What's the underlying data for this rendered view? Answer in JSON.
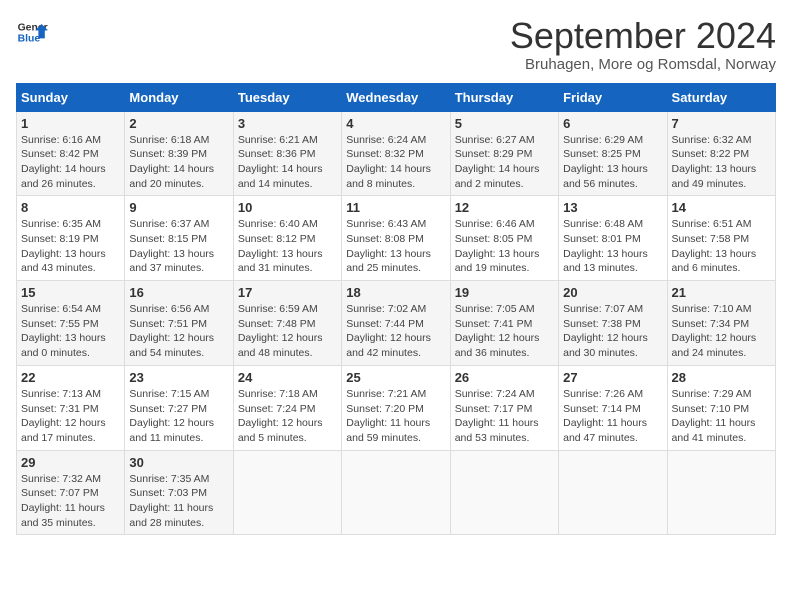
{
  "header": {
    "logo_line1": "General",
    "logo_line2": "Blue",
    "month": "September 2024",
    "location": "Bruhagen, More og Romsdal, Norway"
  },
  "weekdays": [
    "Sunday",
    "Monday",
    "Tuesday",
    "Wednesday",
    "Thursday",
    "Friday",
    "Saturday"
  ],
  "weeks": [
    [
      {
        "day": "1",
        "info": "Sunrise: 6:16 AM\nSunset: 8:42 PM\nDaylight: 14 hours\nand 26 minutes."
      },
      {
        "day": "2",
        "info": "Sunrise: 6:18 AM\nSunset: 8:39 PM\nDaylight: 14 hours\nand 20 minutes."
      },
      {
        "day": "3",
        "info": "Sunrise: 6:21 AM\nSunset: 8:36 PM\nDaylight: 14 hours\nand 14 minutes."
      },
      {
        "day": "4",
        "info": "Sunrise: 6:24 AM\nSunset: 8:32 PM\nDaylight: 14 hours\nand 8 minutes."
      },
      {
        "day": "5",
        "info": "Sunrise: 6:27 AM\nSunset: 8:29 PM\nDaylight: 14 hours\nand 2 minutes."
      },
      {
        "day": "6",
        "info": "Sunrise: 6:29 AM\nSunset: 8:25 PM\nDaylight: 13 hours\nand 56 minutes."
      },
      {
        "day": "7",
        "info": "Sunrise: 6:32 AM\nSunset: 8:22 PM\nDaylight: 13 hours\nand 49 minutes."
      }
    ],
    [
      {
        "day": "8",
        "info": "Sunrise: 6:35 AM\nSunset: 8:19 PM\nDaylight: 13 hours\nand 43 minutes."
      },
      {
        "day": "9",
        "info": "Sunrise: 6:37 AM\nSunset: 8:15 PM\nDaylight: 13 hours\nand 37 minutes."
      },
      {
        "day": "10",
        "info": "Sunrise: 6:40 AM\nSunset: 8:12 PM\nDaylight: 13 hours\nand 31 minutes."
      },
      {
        "day": "11",
        "info": "Sunrise: 6:43 AM\nSunset: 8:08 PM\nDaylight: 13 hours\nand 25 minutes."
      },
      {
        "day": "12",
        "info": "Sunrise: 6:46 AM\nSunset: 8:05 PM\nDaylight: 13 hours\nand 19 minutes."
      },
      {
        "day": "13",
        "info": "Sunrise: 6:48 AM\nSunset: 8:01 PM\nDaylight: 13 hours\nand 13 minutes."
      },
      {
        "day": "14",
        "info": "Sunrise: 6:51 AM\nSunset: 7:58 PM\nDaylight: 13 hours\nand 6 minutes."
      }
    ],
    [
      {
        "day": "15",
        "info": "Sunrise: 6:54 AM\nSunset: 7:55 PM\nDaylight: 13 hours\nand 0 minutes."
      },
      {
        "day": "16",
        "info": "Sunrise: 6:56 AM\nSunset: 7:51 PM\nDaylight: 12 hours\nand 54 minutes."
      },
      {
        "day": "17",
        "info": "Sunrise: 6:59 AM\nSunset: 7:48 PM\nDaylight: 12 hours\nand 48 minutes."
      },
      {
        "day": "18",
        "info": "Sunrise: 7:02 AM\nSunset: 7:44 PM\nDaylight: 12 hours\nand 42 minutes."
      },
      {
        "day": "19",
        "info": "Sunrise: 7:05 AM\nSunset: 7:41 PM\nDaylight: 12 hours\nand 36 minutes."
      },
      {
        "day": "20",
        "info": "Sunrise: 7:07 AM\nSunset: 7:38 PM\nDaylight: 12 hours\nand 30 minutes."
      },
      {
        "day": "21",
        "info": "Sunrise: 7:10 AM\nSunset: 7:34 PM\nDaylight: 12 hours\nand 24 minutes."
      }
    ],
    [
      {
        "day": "22",
        "info": "Sunrise: 7:13 AM\nSunset: 7:31 PM\nDaylight: 12 hours\nand 17 minutes."
      },
      {
        "day": "23",
        "info": "Sunrise: 7:15 AM\nSunset: 7:27 PM\nDaylight: 12 hours\nand 11 minutes."
      },
      {
        "day": "24",
        "info": "Sunrise: 7:18 AM\nSunset: 7:24 PM\nDaylight: 12 hours\nand 5 minutes."
      },
      {
        "day": "25",
        "info": "Sunrise: 7:21 AM\nSunset: 7:20 PM\nDaylight: 11 hours\nand 59 minutes."
      },
      {
        "day": "26",
        "info": "Sunrise: 7:24 AM\nSunset: 7:17 PM\nDaylight: 11 hours\nand 53 minutes."
      },
      {
        "day": "27",
        "info": "Sunrise: 7:26 AM\nSunset: 7:14 PM\nDaylight: 11 hours\nand 47 minutes."
      },
      {
        "day": "28",
        "info": "Sunrise: 7:29 AM\nSunset: 7:10 PM\nDaylight: 11 hours\nand 41 minutes."
      }
    ],
    [
      {
        "day": "29",
        "info": "Sunrise: 7:32 AM\nSunset: 7:07 PM\nDaylight: 11 hours\nand 35 minutes."
      },
      {
        "day": "30",
        "info": "Sunrise: 7:35 AM\nSunset: 7:03 PM\nDaylight: 11 hours\nand 28 minutes."
      },
      {
        "day": "",
        "info": ""
      },
      {
        "day": "",
        "info": ""
      },
      {
        "day": "",
        "info": ""
      },
      {
        "day": "",
        "info": ""
      },
      {
        "day": "",
        "info": ""
      }
    ]
  ]
}
